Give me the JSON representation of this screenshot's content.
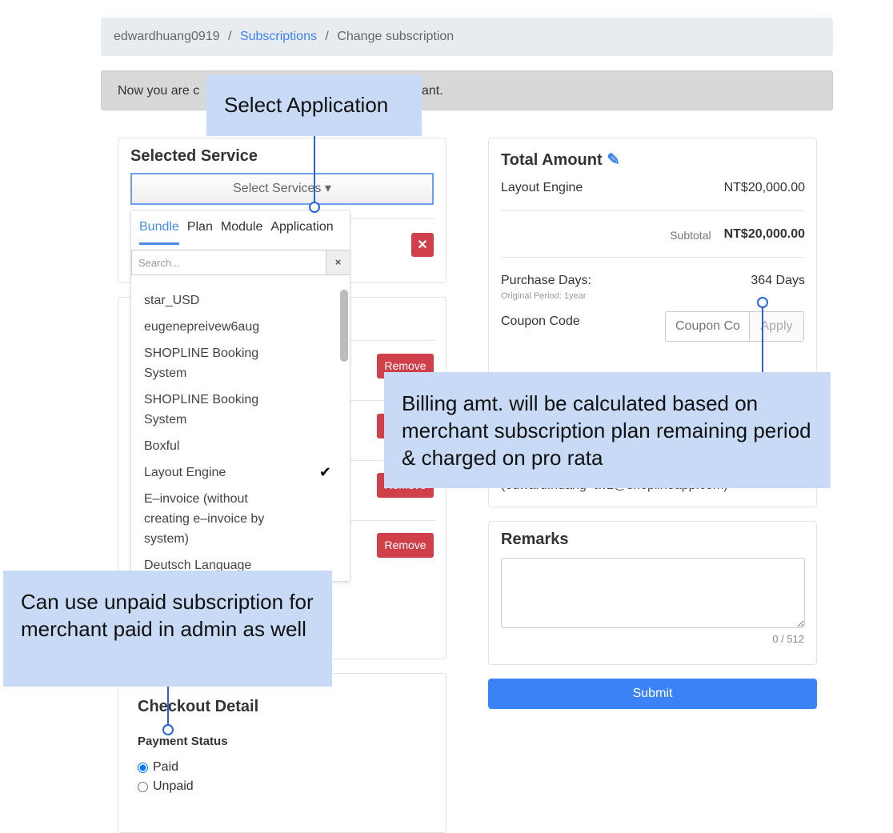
{
  "breadcrumb": {
    "user": "edwardhuang0919",
    "sep": "/",
    "subscriptions": "Subscriptions",
    "current": "Change subscription"
  },
  "alert": {
    "left": "Now you are c",
    "right": "ant."
  },
  "selected_service": {
    "title": "Selected Service",
    "select_label": "Select Services ▾",
    "remove_icon": "×"
  },
  "dropdown": {
    "tabs": [
      "Bundle",
      "Plan",
      "Module",
      "Application"
    ],
    "search_placeholder": "Search...",
    "clear": "×",
    "items": [
      "star_USD",
      "eugenepreivew6aug",
      "SHOPLINE Booking System",
      "SHOPLINE Booking System",
      "Boxful",
      "Layout Engine",
      "E–invoice (without creating e–invoice by system)",
      "Deutsch Language"
    ],
    "checked": "✔"
  },
  "remove_label": "Remove",
  "checkout": {
    "title": "Checkout Detail",
    "payment_status": "Payment Status",
    "options": [
      "Paid",
      "Unpaid"
    ]
  },
  "total": {
    "title": "Total Amount",
    "edit_icon": "✎",
    "item": "Layout Engine",
    "item_price": "NT$20,000.00",
    "subtotal_label": "Subtotal",
    "subtotal": "NT$20,000.00",
    "purchase_days_label": "Purchase Days:",
    "purchase_days": "364 Days",
    "original_period": "Original Period: 1year",
    "coupon_label": "Coupon Code",
    "coupon_placeholder": "Coupon Code",
    "apply": "Apply",
    "email": "(edward.huang+tw2@shoplineapp.com)"
  },
  "remarks": {
    "title": "Remarks",
    "counter": "0 / 512"
  },
  "submit": "Submit",
  "callouts": {
    "select_app": "Select Application",
    "billing": "Billing amt. will be calculated based on merchant subscription plan remaining period & charged on pro rata",
    "unpaid": "Can use unpaid subscription for merchant paid in admin as well"
  },
  "colors": {
    "primary": "#3b82f6",
    "danger": "#d0404a",
    "callout": "#c8daf5"
  }
}
